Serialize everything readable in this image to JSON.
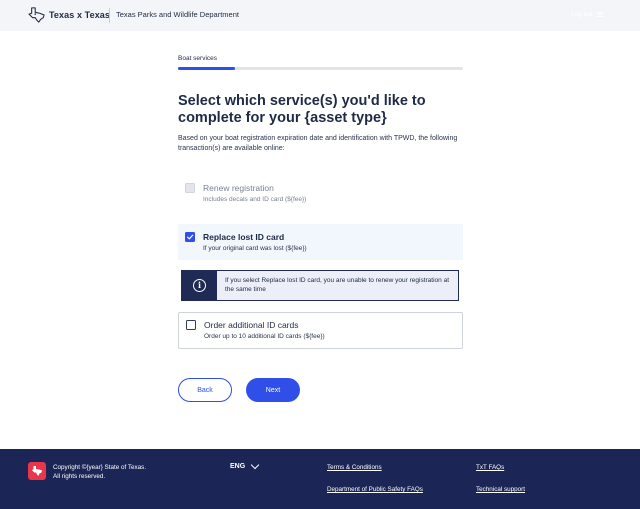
{
  "header": {
    "logo_text": "Texas x Texas",
    "department": "Texas Parks and Wildlife Department",
    "login_label": "Log out"
  },
  "progress": {
    "step_label": "Boat services",
    "fraction": 0.2
  },
  "main": {
    "title": "Select which service(s) you'd like to complete for your {asset type}",
    "intro": "Based on your boat registration expiration date and identification with TPWD, the following transaction(s) are available online:"
  },
  "options": [
    {
      "label": "Renew registration",
      "sub": "Includes decals and ID card (${fee})",
      "state": "disabled"
    },
    {
      "label": "Replace lost ID card",
      "sub": "If your original card was lost (${fee})",
      "state": "checked"
    },
    {
      "label": "Order additional ID cards",
      "sub": "Order up to 10 additional ID cards (${fee})",
      "state": "unchecked"
    }
  ],
  "alert": {
    "text": "If you select Replace lost ID card, you are unable to renew your registration at the same time",
    "icon": "info-icon"
  },
  "buttons": {
    "back": "Back",
    "next": "Next"
  },
  "footer": {
    "copyright_line1": "Copyright ©{year} State of Texas.",
    "copyright_line2": "All rights reserved.",
    "language": "ENG",
    "links": {
      "terms": "Terms & Conditions",
      "dps_faqs": "Department of Public Safety FAQs",
      "txt_faqs": "TxT FAQs",
      "support": "Technical support"
    }
  },
  "colors": {
    "accent": "#2f4fe8",
    "navy": "#1c2656",
    "brand_red": "#e8364a"
  }
}
